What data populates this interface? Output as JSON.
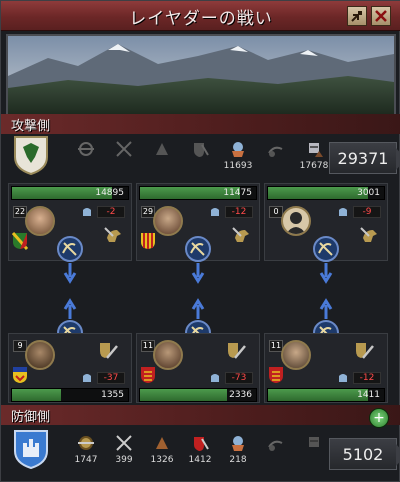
{
  "window": {
    "title": "レイヤダーの戦い"
  },
  "attacker": {
    "label": "攻撃側",
    "total": "29371",
    "units": [
      {
        "icon": "archer-icon",
        "count": ""
      },
      {
        "icon": "pikemen-icon",
        "count": ""
      },
      {
        "icon": "light-infantry-icon",
        "count": ""
      },
      {
        "icon": "heavy-infantry-icon",
        "count": ""
      },
      {
        "icon": "light-cavalry-icon",
        "count": "11693"
      },
      {
        "icon": "horse-archer-icon",
        "count": ""
      },
      {
        "icon": "knight-icon",
        "count": "17678"
      }
    ],
    "flanks": [
      {
        "hp": "14895",
        "hp_fraction": 0.86,
        "level": "22",
        "modifier": "-2"
      },
      {
        "hp": "11475",
        "hp_fraction": 0.86,
        "level": "29",
        "modifier": "-12"
      },
      {
        "hp": "3001",
        "hp_fraction": 0.86,
        "level": "0",
        "modifier": "-9"
      }
    ]
  },
  "defender": {
    "label": "防御側",
    "total": "5102",
    "units": [
      {
        "icon": "archer-icon",
        "count": "1747"
      },
      {
        "icon": "pikemen-icon",
        "count": "399"
      },
      {
        "icon": "light-infantry-icon",
        "count": "1326"
      },
      {
        "icon": "heavy-infantry-icon",
        "count": "1412"
      },
      {
        "icon": "light-cavalry-icon",
        "count": "218"
      },
      {
        "icon": "horse-archer-icon",
        "count": ""
      },
      {
        "icon": "knight-icon",
        "count": ""
      }
    ],
    "flanks": [
      {
        "hp": "1355",
        "hp_fraction": 0.42,
        "level": "9",
        "modifier": "-37"
      },
      {
        "hp": "2336",
        "hp_fraction": 0.75,
        "level": "11",
        "modifier": "-73"
      },
      {
        "hp": "1411",
        "hp_fraction": 0.86,
        "level": "11",
        "modifier": "-12"
      }
    ]
  },
  "colors": {
    "accent": "#6c2727",
    "hp_green": "#3e8a3e",
    "negative": "#ff4a4a"
  }
}
